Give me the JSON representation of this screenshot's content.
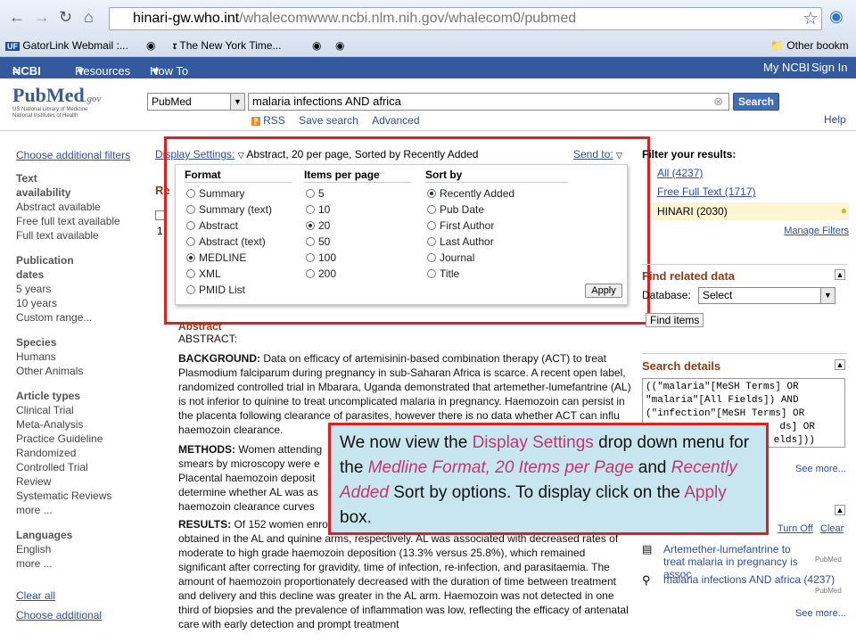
{
  "browser": {
    "url_host": "hinari-gw.who.int",
    "url_path": "/whalecomwww.ncbi.nlm.nih.gov/whalecom0/pubmed",
    "bookmarks": [
      "GatorLink Webmail :...",
      "The New York Time...",
      "Other bookm"
    ]
  },
  "ncbi": {
    "logo": "NCBI",
    "resources": "Resources",
    "howto": "How To",
    "my_ncbi": "My NCBI",
    "sign_in": "Sign In"
  },
  "pubmed": {
    "logo": "PubMed",
    "logo_suffix": ".gov",
    "sub1": "US National Library of Medicine",
    "sub2": "National Institutes of Health",
    "db": "PubMed",
    "query": "malaria infections AND africa",
    "search_btn": "Search",
    "rss": "RSS",
    "save_search": "Save search",
    "advanced": "Advanced",
    "help": "Help"
  },
  "sidebar": {
    "choose_filters": "Choose additional filters",
    "text_h": "Text availability",
    "text_items": [
      "Abstract available",
      "Free full text available",
      "Full text available"
    ],
    "pub_h": "Publication dates",
    "pub_items": [
      "5 years",
      "10 years",
      "Custom range..."
    ],
    "species_h": "Species",
    "species_items": [
      "Humans",
      "Other Animals"
    ],
    "article_h": "Article types",
    "article_items": [
      "Clinical Trial",
      "Meta-Analysis",
      "Practice Guideline",
      "Randomized Controlled Trial",
      "Review",
      "Systematic Reviews",
      "more ..."
    ],
    "lang_h": "Languages",
    "lang_items": [
      "English",
      "more ..."
    ],
    "clear_all": "Clear all",
    "choose_additional": "Choose additional"
  },
  "display": {
    "label": "Display Settings:",
    "summary": "Abstract, 20 per page, Sorted by Recently Added",
    "send_to": "Send to:",
    "format_h": "Format",
    "items_h": "Items per page",
    "sort_h": "Sort by",
    "formats": [
      "Summary",
      "Summary (text)",
      "Abstract",
      "Abstract (text)",
      "MEDLINE",
      "XML",
      "PMID List"
    ],
    "items": [
      "5",
      "10",
      "20",
      "50",
      "100",
      "200"
    ],
    "sorts": [
      "Recently Added",
      "Pub Date",
      "First Author",
      "Last Author",
      "Journal",
      "Title"
    ],
    "apply": "Apply"
  },
  "abstract": {
    "heading": "Abstract",
    "label": "ABSTRACT:",
    "background_h": "BACKGROUND:",
    "background": "Data on efficacy of artemisinin-based combination therapy (ACT) to treat Plasmodium falciparum during pregnancy in sub-Saharan Africa is scarce. A recent open label, randomized controlled trial in Mbarara, Uganda demonstrated that artemether-lumefantrine (AL) is not inferior to quinine to treat uncomplicated malaria in pregnancy. Haemozoin can persist in the placenta following clearance of parasites, however there is no data whether ACT can influ",
    "background_end": "haemozoin clearance.",
    "methods_h": "METHODS:",
    "methods_lines": [
      "Women attending",
      "smears by microscopy were e",
      "Placental haemozoin deposit",
      "determine whether AL was as",
      "haemozoin clearance curves"
    ],
    "results_h": "RESULTS:",
    "results": "Of 152 women enrolled in each arm, there were 97 and 98 placental biopsies obtained in the AL and quinine arms, respectively. AL was associated with decreased rates of moderate to high grade haemozoin deposition (13.3% versus 25.8%), which remained significant after correcting for gravidity, time of infection, re-infection, and parasitaemia. The amount of haemozoin proportionately decreased with the duration of time between treatment and delivery and this decline was greater in the AL arm. Haemozoin was not detected in one third of biopsies and the prevalence of inflammation was low, reflecting the efficacy of antenatal care with early detection and prompt treatment"
  },
  "right": {
    "filter_h": "Filter your results:",
    "filters": [
      "All (4237)",
      "Free Full Text (1717)",
      "HINARI (2030)"
    ],
    "manage_filters": "Manage Filters",
    "related_h": "Find related data",
    "database_label": "Database:",
    "database_value": "Select",
    "find_items": "Find items",
    "details_h": "Search details",
    "details_lines": [
      "((\"malaria\"[MeSH Terms] OR",
      "\"malaria\"[All Fields]) AND",
      "(\"infection\"[MeSH Terms] OR",
      "ds] OR",
      "elds]))"
    ],
    "see_more": "See more...",
    "turn_off": "Turn Off",
    "clear": "Clear",
    "recent1": "Artemether-lumefantrine to treat malaria in pregnancy is assoc",
    "recent1_src": "PubMed",
    "recent2": "malaria infections AND africa (4237)",
    "recent2_src": "PubMed"
  },
  "callout": {
    "p1": "We now view the ",
    "h1": "Display Settings",
    "p2": " drop down menu for the ",
    "h2": "Medline Format, 20 Items per Page",
    "p3": " and ",
    "h3": "Recently Added",
    "p4": " Sort by options.  To display click on the ",
    "h4": "Apply",
    "p5": " box."
  },
  "colors": {
    "ncbi_bar": "#34599d",
    "highlight": "#e02020",
    "callout_bg": "#c8e6f0",
    "callout_accent": "#c03870"
  }
}
